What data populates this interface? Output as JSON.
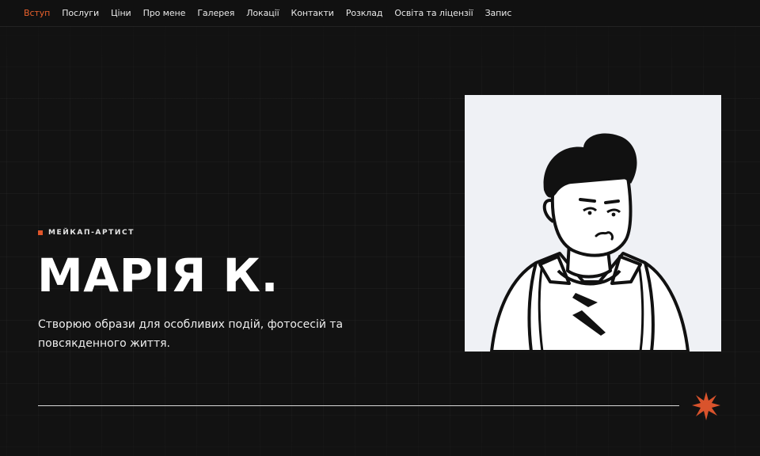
{
  "nav": {
    "items": [
      {
        "label": "Вступ",
        "active": true
      },
      {
        "label": "Послуги",
        "active": false
      },
      {
        "label": "Ціни",
        "active": false
      },
      {
        "label": "Про мене",
        "active": false
      },
      {
        "label": "Галерея",
        "active": false
      },
      {
        "label": "Локації",
        "active": false
      },
      {
        "label": "Контакти",
        "active": false
      },
      {
        "label": "Розклад",
        "active": false
      },
      {
        "label": "Освіта та ліцензії",
        "active": false
      },
      {
        "label": "Запис",
        "active": false
      }
    ]
  },
  "hero": {
    "eyebrow": "МЕЙКАП-АРТИСТ",
    "title": "МАРІЯ К.",
    "subtitle": "Створюю образи для особливих подій, фотосесій та повсякденного життя.",
    "portrait_icon": "cartoon-portrait-illustration",
    "accent_icon": "starburst-icon"
  },
  "colors": {
    "background": "#121212",
    "accent": "#e0552a",
    "text": "#ffffff",
    "portrait_bg": "#eff1f5"
  }
}
